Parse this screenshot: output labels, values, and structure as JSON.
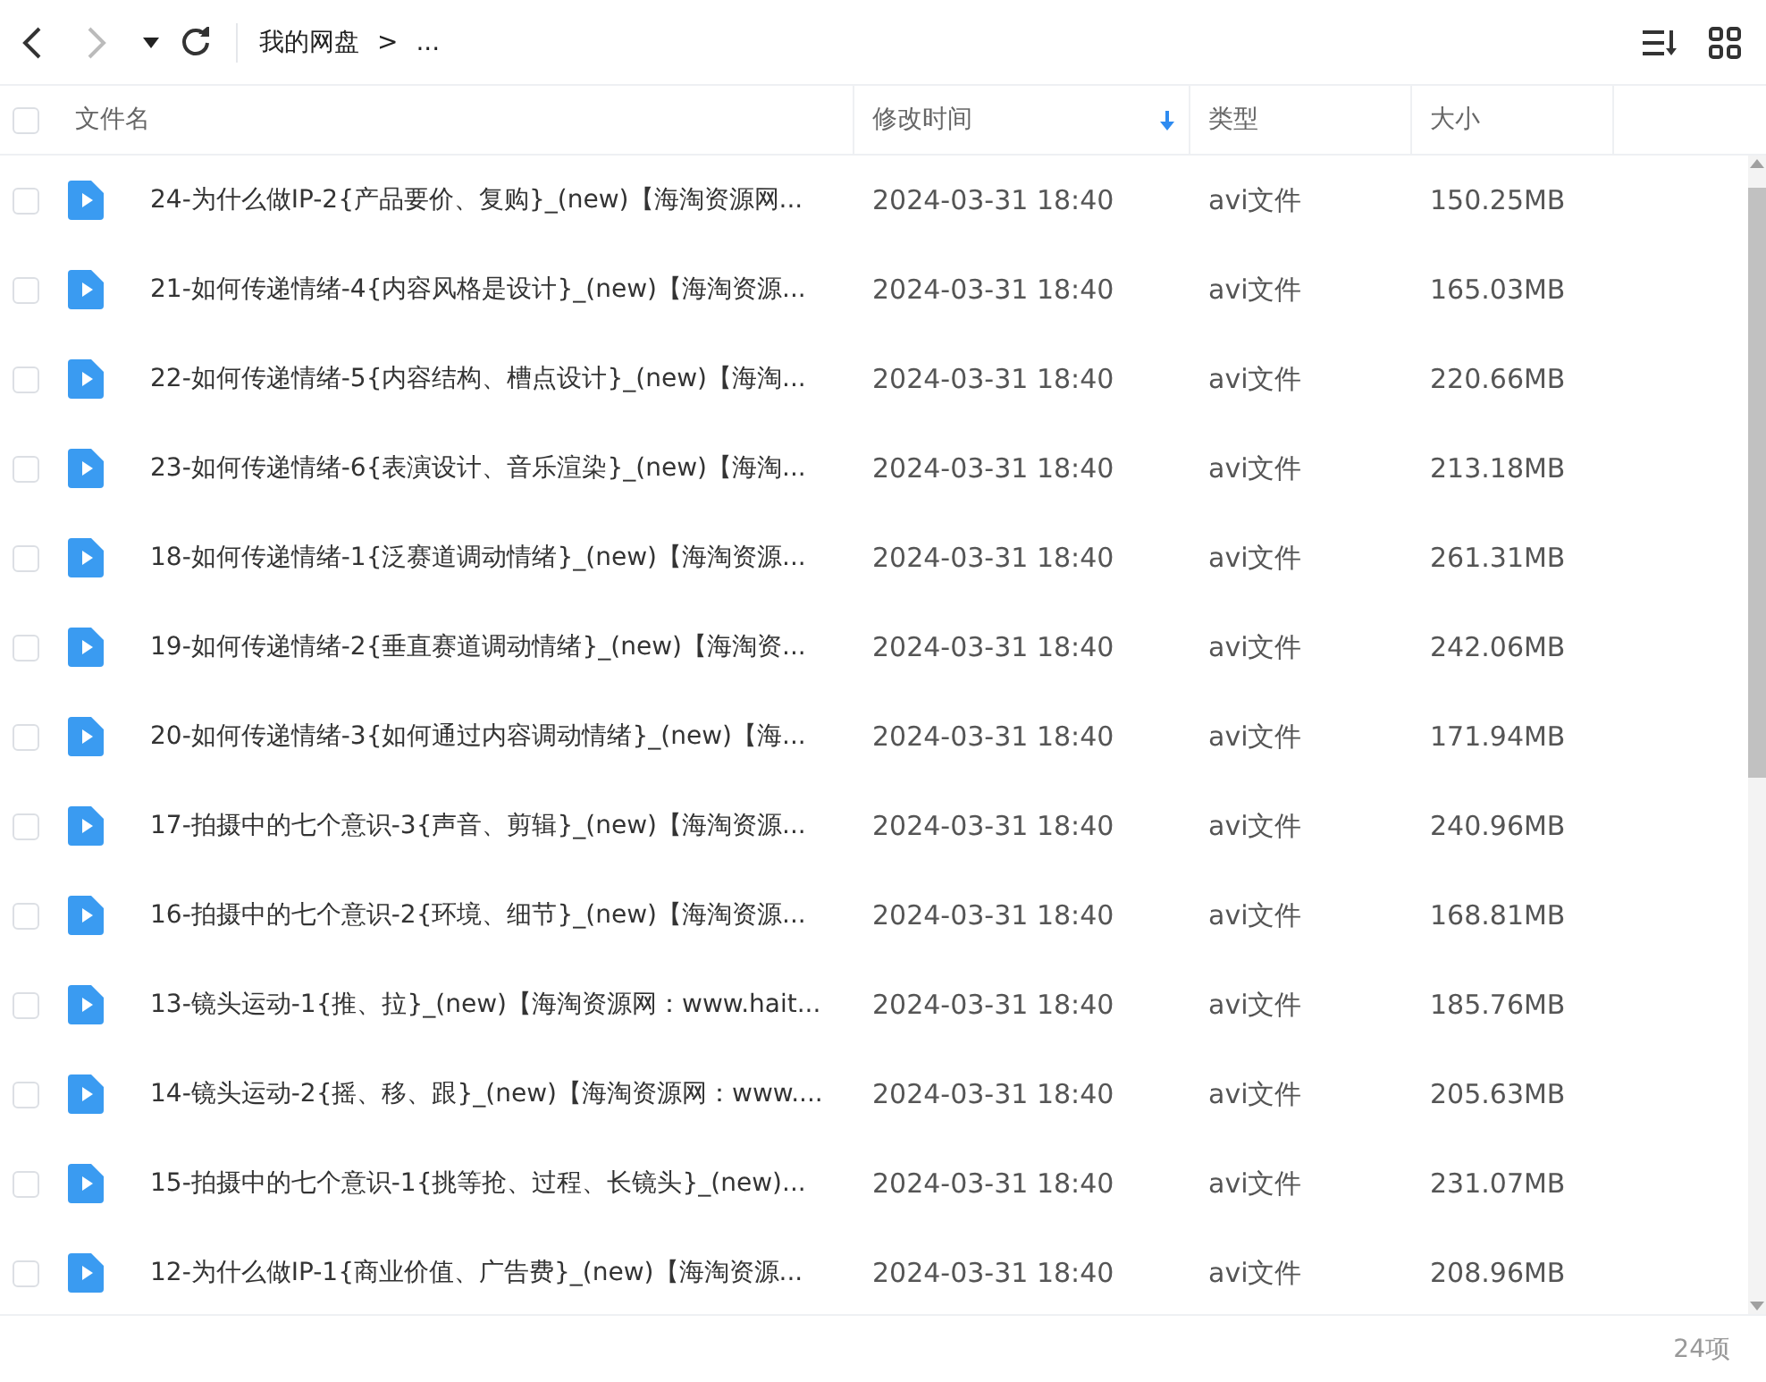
{
  "toolbar": {
    "breadcrumb": [
      "我的网盘",
      "..."
    ],
    "separator": ">"
  },
  "table": {
    "select_all": {
      "checked": false
    },
    "columns": [
      {
        "label": "文件名",
        "sorted": false
      },
      {
        "label": "修改时间",
        "sorted": true
      },
      {
        "label": "类型",
        "sorted": false
      },
      {
        "label": "大小",
        "sorted": false
      }
    ],
    "rows": [
      {
        "name": "24-为什么做IP-2{产品要价、复购}_(new)【海淘资源网...",
        "modified": "2024-03-31 18:40",
        "type": "avi文件",
        "size": "150.25MB",
        "selected": false
      },
      {
        "name": "21-如何传递情绪-4{内容风格是设计}_(new)【海淘资源...",
        "modified": "2024-03-31 18:40",
        "type": "avi文件",
        "size": "165.03MB",
        "selected": false
      },
      {
        "name": "22-如何传递情绪-5{内容结构、槽点设计}_(new)【海淘...",
        "modified": "2024-03-31 18:40",
        "type": "avi文件",
        "size": "220.66MB",
        "selected": false
      },
      {
        "name": "23-如何传递情绪-6{表演设计、音乐渲染}_(new)【海淘...",
        "modified": "2024-03-31 18:40",
        "type": "avi文件",
        "size": "213.18MB",
        "selected": false
      },
      {
        "name": "18-如何传递情绪-1{泛赛道调动情绪}_(new)【海淘资源...",
        "modified": "2024-03-31 18:40",
        "type": "avi文件",
        "size": "261.31MB",
        "selected": false
      },
      {
        "name": "19-如何传递情绪-2{垂直赛道调动情绪}_(new)【海淘资...",
        "modified": "2024-03-31 18:40",
        "type": "avi文件",
        "size": "242.06MB",
        "selected": false
      },
      {
        "name": "20-如何传递情绪-3{如何通过内容调动情绪}_(new)【海...",
        "modified": "2024-03-31 18:40",
        "type": "avi文件",
        "size": "171.94MB",
        "selected": false
      },
      {
        "name": "17-拍摄中的七个意识-3{声音、剪辑}_(new)【海淘资源...",
        "modified": "2024-03-31 18:40",
        "type": "avi文件",
        "size": "240.96MB",
        "selected": false
      },
      {
        "name": "16-拍摄中的七个意识-2{环境、细节}_(new)【海淘资源...",
        "modified": "2024-03-31 18:40",
        "type": "avi文件",
        "size": "168.81MB",
        "selected": false
      },
      {
        "name": "13-镜头运动-1{推、拉}_(new)【海淘资源网：www.hait...",
        "modified": "2024-03-31 18:40",
        "type": "avi文件",
        "size": "185.76MB",
        "selected": false
      },
      {
        "name": "14-镜头运动-2{摇、移、跟}_(new)【海淘资源网：www....",
        "modified": "2024-03-31 18:40",
        "type": "avi文件",
        "size": "205.63MB",
        "selected": false
      },
      {
        "name": "15-拍摄中的七个意识-1{挑等抢、过程、长镜头}_(new)...",
        "modified": "2024-03-31 18:40",
        "type": "avi文件",
        "size": "231.07MB",
        "selected": false
      },
      {
        "name": "12-为什么做IP-1{商业价值、广告费}_(new)【海淘资源...",
        "modified": "2024-03-31 18:40",
        "type": "avi文件",
        "size": "208.96MB",
        "selected": false
      }
    ]
  },
  "status_bar": {
    "count": "24项"
  }
}
